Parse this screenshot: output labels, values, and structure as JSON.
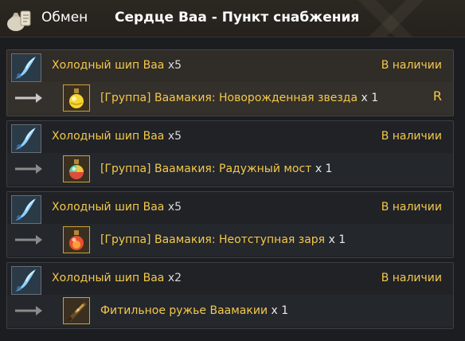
{
  "header": {
    "tab_label": "Обмен",
    "title": "Сердце Ваа - Пункт снабжения"
  },
  "entries": [
    {
      "cost_item": "Холодный шип Ваа",
      "cost_qty": "x5",
      "status": "В наличии",
      "reward_item": "[Группа] Ваамакия: Новорожденная звезда",
      "reward_qty": "x 1",
      "reward_icon": "yellow-potion-icon",
      "hotkey": "R",
      "selected": true
    },
    {
      "cost_item": "Холодный шип Ваа",
      "cost_qty": "x5",
      "status": "В наличии",
      "reward_item": "[Группа] Ваамакия: Радужный мост",
      "reward_qty": "x 1",
      "reward_icon": "rainbow-potion-icon"
    },
    {
      "cost_item": "Холодный шип Ваа",
      "cost_qty": "x5",
      "status": "В наличии",
      "reward_item": "[Группа] Ваамакия: Неотступная заря",
      "reward_qty": "x 1",
      "reward_icon": "red-potion-icon"
    },
    {
      "cost_item": "Холодный шип Ваа",
      "cost_qty": "x2",
      "status": "В наличии",
      "reward_item": "Фитильное ружье Ваамакии",
      "reward_qty": "x 1",
      "reward_icon": "matchlock-gun-icon"
    }
  ],
  "colors": {
    "accent_text": "#f3c84b",
    "background": "#1b1d21",
    "selected_row": "#302c28"
  }
}
